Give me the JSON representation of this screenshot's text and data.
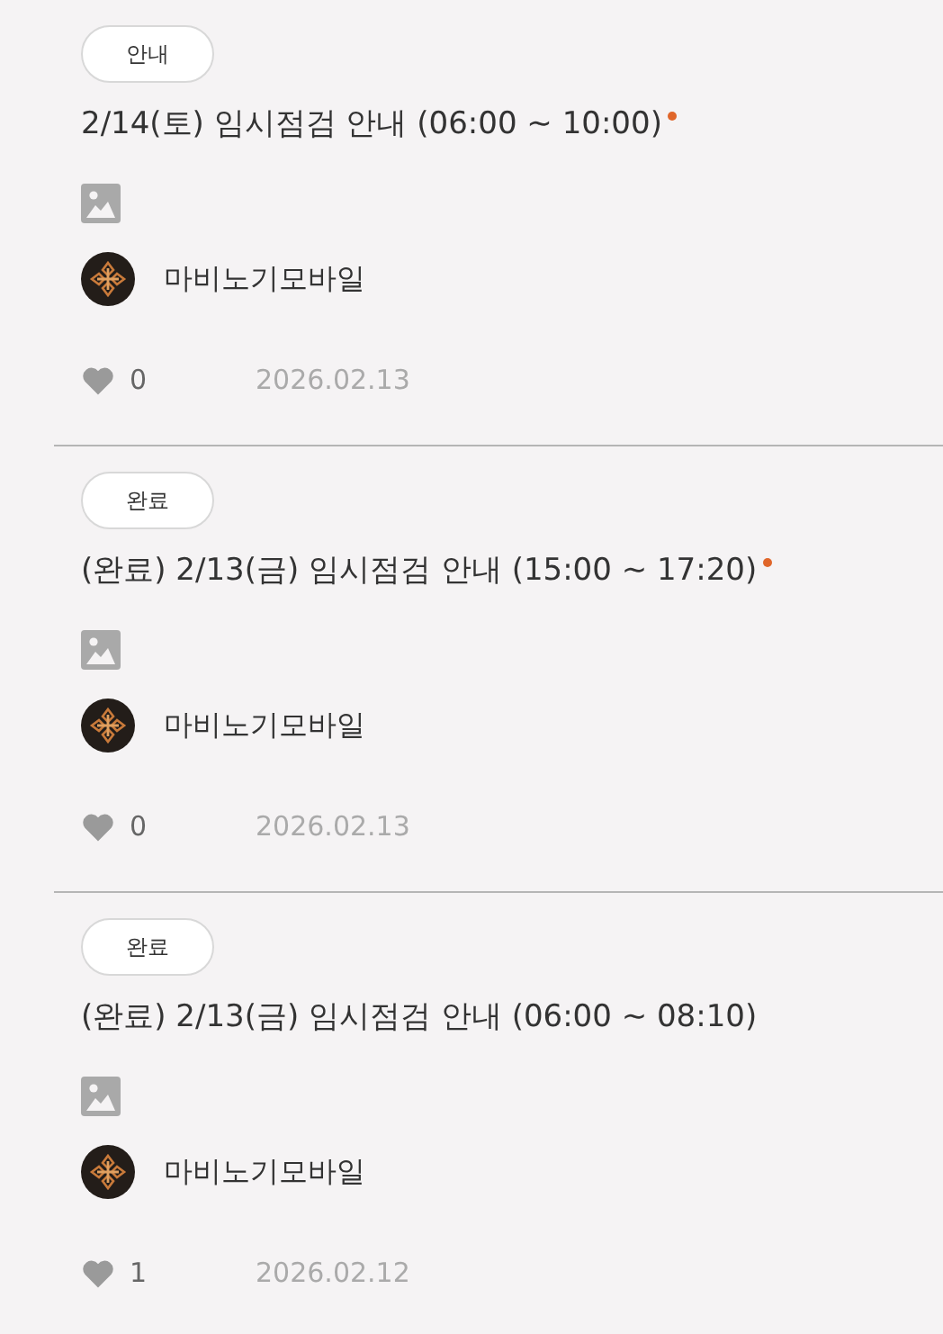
{
  "posts": [
    {
      "tag": "안내",
      "title": "2/14(토) 임시점검 안내 (06:00 ~ 10:00)",
      "new": true,
      "has_image": true,
      "author": "마비노기모바일",
      "likes": "0",
      "date": "2026.02.13"
    },
    {
      "tag": "완료",
      "title": "(완료) 2/13(금) 임시점검 안내 (15:00 ~ 17:20)",
      "new": true,
      "has_image": true,
      "author": "마비노기모바일",
      "likes": "0",
      "date": "2026.02.13"
    },
    {
      "tag": "완료",
      "title": "(완료) 2/13(금) 임시점검 안내 (06:00 ~ 08:10)",
      "new": false,
      "has_image": true,
      "author": "마비노기모바일",
      "likes": "1",
      "date": "2026.02.12"
    }
  ]
}
